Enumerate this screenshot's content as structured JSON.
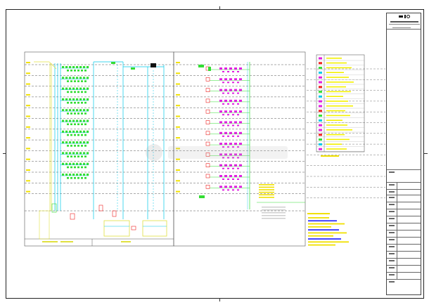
{
  "drawing": {
    "floor_labels": [
      "",
      "",
      "",
      "",
      "",
      "",
      "",
      "",
      "",
      "",
      "",
      "",
      "",
      "",
      "",
      "",
      "",
      "",
      ""
    ],
    "legend_rows": 20,
    "notes_title": "",
    "colors": {
      "background": "#ffffff",
      "frame": "#222222",
      "grid_dash": "#555555",
      "pipe_cyan": "#00c8e8",
      "fixture_green": "#33dd33",
      "fixture_magenta": "#e020e0",
      "fixture_red": "#ee2020",
      "annotation_yellow": "#f0e000",
      "annotation_blue": "#3030ff",
      "legend_yellow": "#f3f000"
    }
  },
  "title_block": {
    "company_mark": "",
    "rows": 20
  },
  "watermark": {
    "text": ""
  }
}
